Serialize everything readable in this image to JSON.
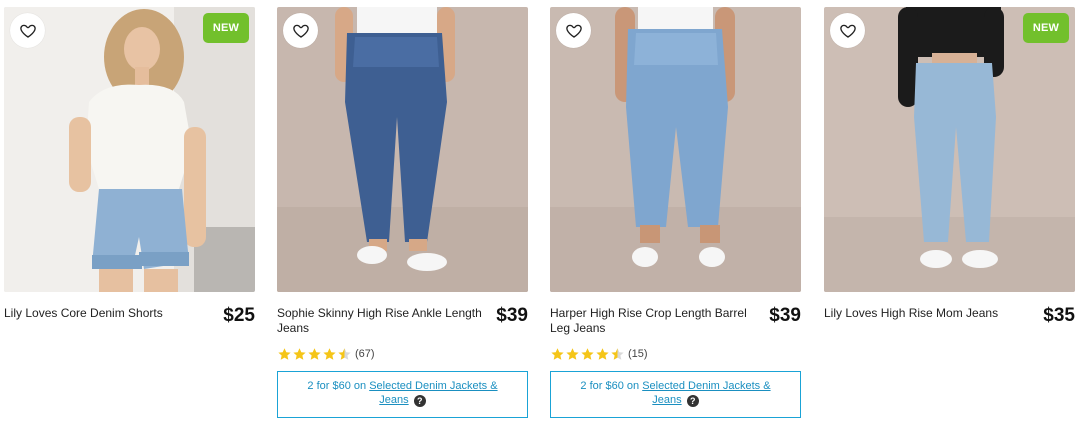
{
  "products": [
    {
      "name": "Lily Loves Core Denim Shorts",
      "price": "$25",
      "badge": "NEW",
      "image_alt": "Woman in white shirt and denim shorts"
    },
    {
      "name": "Sophie Skinny High Rise Ankle Length Jeans",
      "price": "$39",
      "rating": 4.5,
      "review_count": "(67)",
      "promo": {
        "prefix": "2 for $60 on",
        "link": "Selected Denim Jackets &",
        "link2": "Jeans",
        "help_icon": "question-icon"
      }
    },
    {
      "name": "Harper High Rise Crop Length Barrel Leg Jeans",
      "price": "$39",
      "rating": 4.5,
      "review_count": "(15)",
      "promo": {
        "prefix": "2 for $60 on",
        "link": "Selected Denim Jackets &",
        "link2": "Jeans",
        "help_icon": "question-icon"
      }
    },
    {
      "name": "Lily Loves High Rise Mom Jeans",
      "price": "$35",
      "badge": "NEW"
    }
  ],
  "icons": {
    "wishlist": "heart-icon",
    "star": "star-icon",
    "help": "question-icon"
  },
  "colors": {
    "badge": "#72c02c",
    "star": "#f5c518",
    "promo_border": "#1aa3d6",
    "promo_text": "#1a8fc0"
  }
}
